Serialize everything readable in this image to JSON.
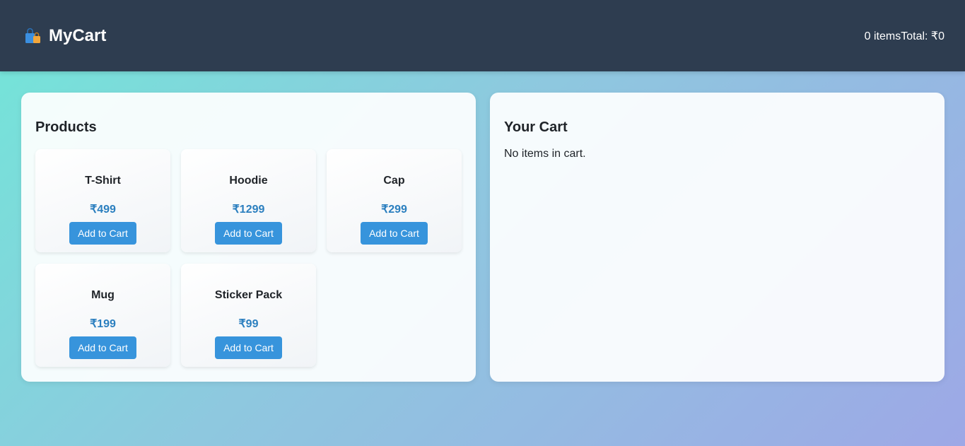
{
  "header": {
    "brand": "MyCart",
    "brand_icon": "shopping-bags-icon",
    "item_count": "0 items",
    "total": "Total: ₹0"
  },
  "products": {
    "title": "Products",
    "button_label": "Add to Cart",
    "items": [
      {
        "name": "T-Shirt",
        "price": "₹499"
      },
      {
        "name": "Hoodie",
        "price": "₹1299"
      },
      {
        "name": "Cap",
        "price": "₹299"
      },
      {
        "name": "Mug",
        "price": "₹199"
      },
      {
        "name": "Sticker Pack",
        "price": "₹99"
      }
    ]
  },
  "cart": {
    "title": "Your Cart",
    "empty_message": "No items in cart."
  },
  "colors": {
    "header_bg": "#2e3d50",
    "accent": "#3794dc",
    "price": "#2b7fbf"
  }
}
